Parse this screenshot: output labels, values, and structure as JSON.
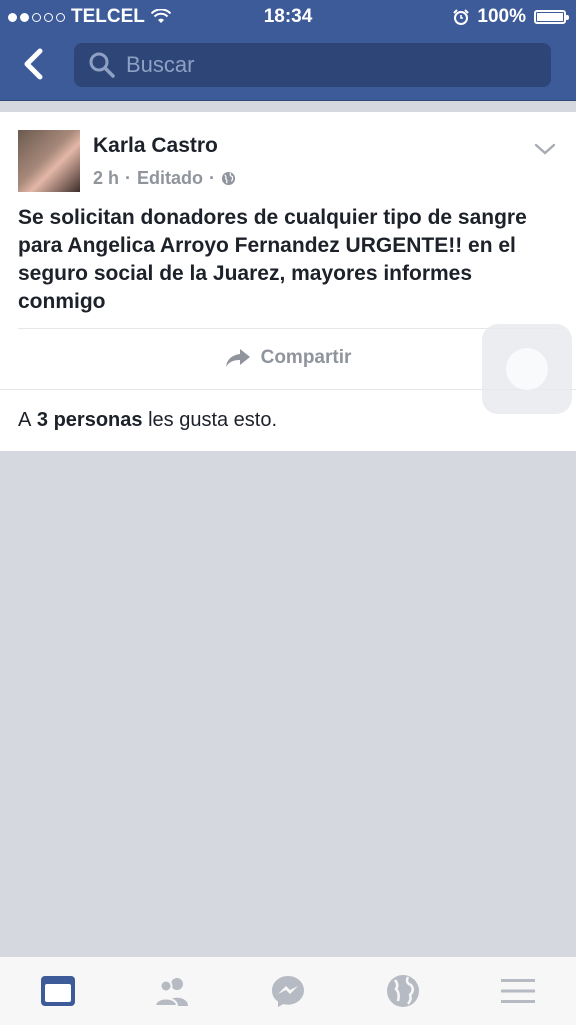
{
  "status_bar": {
    "carrier": "TELCEL",
    "time": "18:34",
    "battery": "100%"
  },
  "header": {
    "search_placeholder": "Buscar"
  },
  "post": {
    "author": "Karla Castro",
    "time": "2 h",
    "edited": "Editado",
    "separator": "·",
    "text": "Se solicitan donadores de cualquier tipo de sangre para Angelica Arroyo Fernandez URGENTE!! en el seguro social de la Juarez, mayores informes conmigo",
    "share_label": "Compartir",
    "likes_prefix": "A",
    "likes_bold": "3 personas",
    "likes_suffix": "les gusta esto."
  },
  "tabbar": {
    "active_color": "#3d5b99",
    "inactive_color": "#b6bac2"
  }
}
